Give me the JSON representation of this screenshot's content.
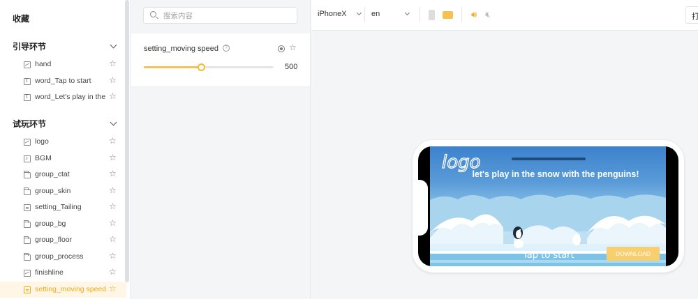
{
  "sidebar": {
    "title": "收藏",
    "groups": [
      {
        "label": "引导环节",
        "items": [
          {
            "label": "hand",
            "icon": "image-icon"
          },
          {
            "label": "word_Tap to start",
            "icon": "text-icon"
          },
          {
            "label": "word_Let's play in the ...",
            "icon": "text-icon"
          }
        ]
      },
      {
        "label": "试玩环节",
        "items": [
          {
            "label": "logo",
            "icon": "image-icon"
          },
          {
            "label": "BGM",
            "icon": "audio-icon"
          },
          {
            "label": "group_ctat",
            "icon": "folder-icon"
          },
          {
            "label": "group_skin",
            "icon": "folder-icon"
          },
          {
            "label": "setting_Tailing",
            "icon": "setting-icon"
          },
          {
            "label": "group_bg",
            "icon": "folder-icon"
          },
          {
            "label": "group_floor",
            "icon": "folder-icon"
          },
          {
            "label": "group_process",
            "icon": "folder-icon"
          },
          {
            "label": "finishline",
            "icon": "image-icon"
          },
          {
            "label": "setting_moving speed",
            "icon": "setting-icon",
            "active": true
          }
        ]
      }
    ]
  },
  "panel": {
    "search_placeholder": "搜索内容",
    "property": {
      "name": "setting_moving speed",
      "help": "?",
      "value": "500",
      "slider_fraction": 0.44
    }
  },
  "toolbar": {
    "device": "iPhoneX",
    "language": "en",
    "button_label": "打"
  },
  "preview": {
    "logo_text": "logo",
    "headline": "let's play in the snow with the penguins!",
    "tap_text": "Tap to start",
    "download_label": "DOWNLOAD"
  },
  "colors": {
    "accent": "#f0a81c",
    "active_bg": "#fff6e5"
  }
}
